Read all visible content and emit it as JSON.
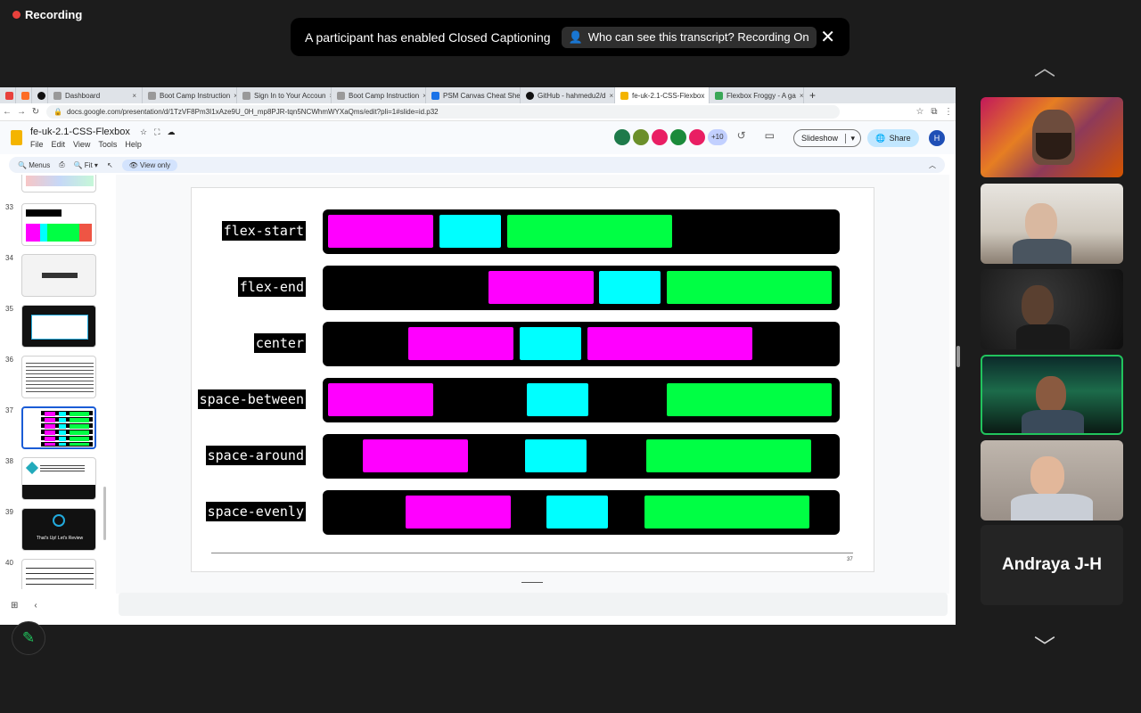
{
  "zoom": {
    "recording_label": "Recording",
    "caption_message": "A participant has enabled Closed Captioning",
    "who_button_label": "Who can see this transcript? Recording On",
    "close_glyph": "✕",
    "participant_name": "Andraya J-H"
  },
  "browser": {
    "tabs": [
      {
        "label": "Dashboard",
        "color": "#e8413c"
      },
      {
        "label": "Boot Camp Instruction",
        "color": "#333"
      },
      {
        "label": "Sign In to Your Accoun",
        "color": "#666"
      },
      {
        "label": "Boot Camp Instruction",
        "color": "#333"
      },
      {
        "label": "PSM Canvas Cheat She",
        "color": "#1a73e8"
      },
      {
        "label": "GitHub - hahmedu2/d",
        "color": "#111"
      },
      {
        "label": "fe-uk-2.1-CSS-Flexbox",
        "color": "#f4b400"
      },
      {
        "label": "Flexbox Froggy - A ga",
        "color": "#3aa757"
      }
    ],
    "url": "docs.google.com/presentation/d/1TzVF8Pm3I1xAze9U_0H_mp8PJR-tqn5NCWhmWYXaQms/edit?pli=1#slide=id.p32"
  },
  "docs": {
    "title": "fe-uk-2.1-CSS-Flexbox",
    "menu": [
      "File",
      "Edit",
      "View",
      "Tools",
      "Help"
    ],
    "avatar_count": "+10",
    "slideshow_label": "Slideshow",
    "share_label": "Share",
    "user_initial": "H",
    "toolbar": {
      "menus": "Menus",
      "zoom": "Fit",
      "view_only": "View only"
    }
  },
  "filmstrip": {
    "numbers": [
      "33",
      "34",
      "35",
      "36",
      "37",
      "38",
      "39",
      "40"
    ],
    "thumb_39_text": "That's Up! Let's Review"
  },
  "slide": {
    "number": "37",
    "rows": [
      {
        "label": "flex-start"
      },
      {
        "label": "flex-end"
      },
      {
        "label": "center"
      },
      {
        "label": "space-between"
      },
      {
        "label": "space-around"
      },
      {
        "label": "space-evenly"
      }
    ],
    "colors": {
      "magenta": "#ff00ff",
      "cyan": "#00ffff",
      "green": "#00ff44"
    }
  }
}
